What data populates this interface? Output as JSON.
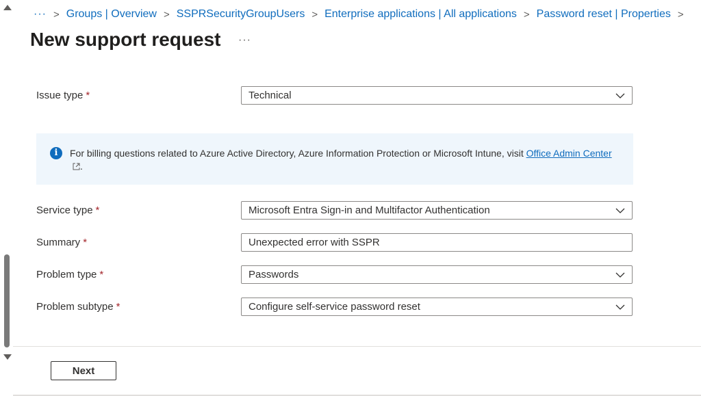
{
  "breadcrumb": {
    "overflow": "···",
    "items": [
      "Groups | Overview",
      "SSPRSecurityGroupUsers",
      "Enterprise applications | All applications",
      "Password reset | Properties"
    ]
  },
  "page": {
    "title": "New support request",
    "more": "···"
  },
  "form": {
    "issue_type": {
      "label": "Issue type",
      "required": "*",
      "value": "Technical"
    },
    "info": {
      "text": "For billing questions related to Azure Active Directory, Azure Information Protection or Microsoft Intune, visit ",
      "link": "Office Admin Center",
      "end": "."
    },
    "service_type": {
      "label": "Service type",
      "required": "*",
      "value": "Microsoft Entra Sign-in and Multifactor Authentication"
    },
    "summary": {
      "label": "Summary",
      "required": "*",
      "value": "Unexpected error with SSPR"
    },
    "problem_type": {
      "label": "Problem type",
      "required": "*",
      "value": "Passwords"
    },
    "problem_subtype": {
      "label": "Problem subtype",
      "required": "*",
      "value": "Configure self-service password reset"
    }
  },
  "footer": {
    "next_label": "Next"
  },
  "colors": {
    "accent": "#0f6cbd",
    "required": "#a4262c",
    "info_bg": "#eff6fc"
  }
}
